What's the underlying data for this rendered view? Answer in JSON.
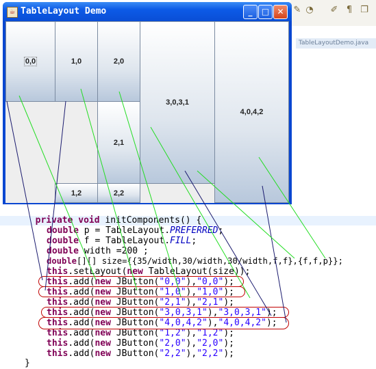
{
  "ide": {
    "editor_tab_label": "TableLayoutDemo.java"
  },
  "window": {
    "title": "TableLayout Demo",
    "minimize_label": "_",
    "maximize_label": "□",
    "close_label": "✕"
  },
  "buttons": [
    {
      "label": "0,0"
    },
    {
      "label": "1,0"
    },
    {
      "label": "2,0"
    },
    {
      "label": "3,0,3,1"
    },
    {
      "label": "4,0,4,2"
    },
    {
      "label": "2,1"
    },
    {
      "label": "1,2"
    },
    {
      "label": "2,2"
    }
  ],
  "code": {
    "lines": [
      "private void initComponents() {",
      "",
      "    double p = TableLayout.PREFERRED;",
      "    double f = TableLayout.FILL;",
      "    double width =200 ;",
      "    double[][] size={{35/width,30/width,30/width,f,f},{f,f,p}};",
      "    this.setLayout(new TableLayout(size));",
      "    this.add(new JButton(\"0,0\"),\"0,0\");",
      "    this.add(new JButton(\"1,0\"),\"1,0\");",
      "    this.add(new JButton(\"2,1\"),\"2,1\");",
      "    this.add(new JButton(\"3,0,3,1\"),\"3,0,3,1\");",
      "    this.add(new JButton(\"4,0,4,2\"),\"4,0,4,2\");",
      "    this.add(new JButton(\"1,2\"),\"1,2\");",
      "    this.add(new JButton(\"2,0\"),\"2,0\");",
      "    this.add(new JButton(\"2,2\"),\"2,2\");",
      "}"
    ]
  }
}
